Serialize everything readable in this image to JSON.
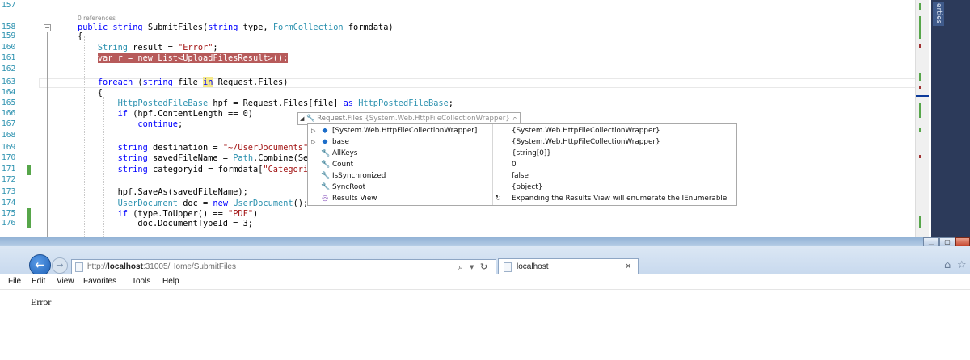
{
  "editor": {
    "lines": [
      {
        "num": "157",
        "segments": []
      },
      {
        "num": "",
        "segments": [
          {
            "t": "0 references",
            "c": "refs"
          }
        ]
      },
      {
        "num": "158",
        "segments": [
          {
            "t": "public ",
            "c": "kw"
          },
          {
            "t": "string ",
            "c": "kw"
          },
          {
            "t": "SubmitFiles(",
            "c": ""
          },
          {
            "t": "string ",
            "c": "kw"
          },
          {
            "t": "type, ",
            "c": ""
          },
          {
            "t": "FormCollection",
            "c": "ty"
          },
          {
            "t": " formdata)",
            "c": ""
          }
        ]
      },
      {
        "num": "159",
        "segments": [
          {
            "t": "{",
            "c": ""
          }
        ]
      },
      {
        "num": "160",
        "segments": [
          {
            "t": "    ",
            "c": ""
          },
          {
            "t": "String",
            "c": "ty"
          },
          {
            "t": " result = ",
            "c": ""
          },
          {
            "t": "\"Error\"",
            "c": "st"
          },
          {
            "t": ";",
            "c": ""
          }
        ]
      },
      {
        "num": "161",
        "segments": [
          {
            "t": "    ",
            "c": ""
          },
          {
            "t": "var r = new List<UploadFilesResult>();",
            "c": "hl-line"
          }
        ]
      },
      {
        "num": "162",
        "segments": []
      },
      {
        "num": "163",
        "segments": [
          {
            "t": "    ",
            "c": ""
          },
          {
            "t": "foreach ",
            "c": "kw"
          },
          {
            "t": "(",
            "c": ""
          },
          {
            "t": "string ",
            "c": "kw"
          },
          {
            "t": "file ",
            "c": ""
          },
          {
            "t": "in",
            "c": "kw hl-in"
          },
          {
            "t": " Request.Files)",
            "c": ""
          }
        ]
      },
      {
        "num": "164",
        "segments": [
          {
            "t": "    {",
            "c": ""
          }
        ]
      },
      {
        "num": "165",
        "segments": [
          {
            "t": "        ",
            "c": ""
          },
          {
            "t": "HttpPostedFileBase",
            "c": "ty"
          },
          {
            "t": " hpf = Request.Files[file] ",
            "c": ""
          },
          {
            "t": "as ",
            "c": "kw"
          },
          {
            "t": "HttpPostedFileBase",
            "c": "ty"
          },
          {
            "t": ";",
            "c": ""
          }
        ]
      },
      {
        "num": "166",
        "segments": [
          {
            "t": "        ",
            "c": ""
          },
          {
            "t": "if ",
            "c": "kw"
          },
          {
            "t": "(hpf.ContentLength == 0)",
            "c": ""
          }
        ]
      },
      {
        "num": "167",
        "segments": [
          {
            "t": "            ",
            "c": ""
          },
          {
            "t": "continue",
            "c": "kw"
          },
          {
            "t": ";",
            "c": ""
          }
        ]
      },
      {
        "num": "168",
        "segments": []
      },
      {
        "num": "169",
        "segments": [
          {
            "t": "        ",
            "c": ""
          },
          {
            "t": "string ",
            "c": "kw"
          },
          {
            "t": "destination = ",
            "c": ""
          },
          {
            "t": "\"~/UserDocuments\"",
            "c": "st"
          }
        ]
      },
      {
        "num": "170",
        "segments": [
          {
            "t": "        ",
            "c": ""
          },
          {
            "t": "string ",
            "c": "kw"
          },
          {
            "t": "savedFileName = ",
            "c": ""
          },
          {
            "t": "Path",
            "c": "ty"
          },
          {
            "t": ".Combine(Se",
            "c": ""
          }
        ]
      },
      {
        "num": "171",
        "segments": [
          {
            "t": "        ",
            "c": ""
          },
          {
            "t": "string ",
            "c": "kw"
          },
          {
            "t": "categoryid = formdata[",
            "c": ""
          },
          {
            "t": "\"Categori",
            "c": "st"
          }
        ]
      },
      {
        "num": "172",
        "segments": []
      },
      {
        "num": "173",
        "segments": [
          {
            "t": "        hpf.SaveAs(savedFileName);",
            "c": ""
          }
        ]
      },
      {
        "num": "174",
        "segments": [
          {
            "t": "        ",
            "c": ""
          },
          {
            "t": "UserDocument",
            "c": "ty"
          },
          {
            "t": " doc = ",
            "c": ""
          },
          {
            "t": "new ",
            "c": "kw"
          },
          {
            "t": "UserDocument",
            "c": "ty"
          },
          {
            "t": "();",
            "c": ""
          }
        ]
      },
      {
        "num": "175",
        "segments": [
          {
            "t": "        ",
            "c": ""
          },
          {
            "t": "if ",
            "c": "kw"
          },
          {
            "t": "(type.ToUpper() == ",
            "c": ""
          },
          {
            "t": "\"PDF\"",
            "c": "st"
          },
          {
            "t": ")",
            "c": ""
          }
        ]
      },
      {
        "num": "176",
        "segments": [
          {
            "t": "            doc.DocumentTypeId = 3;",
            "c": ""
          }
        ]
      }
    ]
  },
  "datatip": {
    "expression": "Request.Files",
    "value": "{System.Web.HttpFileCollectionWrapper}",
    "rows": [
      {
        "expand": "▷",
        "icon": "object-icon",
        "name": "[System.Web.HttpFileCollectionWrapper]",
        "value": "{System.Web.HttpFileCollectionWrapper}"
      },
      {
        "expand": "▷",
        "icon": "object-icon",
        "name": "base",
        "value": "{System.Web.HttpFileCollectionWrapper}"
      },
      {
        "expand": "",
        "icon": "wrench-icon",
        "name": "AllKeys",
        "value": "{string[0]}"
      },
      {
        "expand": "",
        "icon": "wrench-icon",
        "name": "Count",
        "value": "0"
      },
      {
        "expand": "",
        "icon": "wrench-icon",
        "name": "IsSynchronized",
        "value": "false"
      },
      {
        "expand": "",
        "icon": "wrench-icon",
        "name": "SyncRoot",
        "value": "{object}"
      },
      {
        "expand": "",
        "icon": "results-view-icon",
        "name": "Results View",
        "value": "Expanding the Results View will enumerate the IEnumerable",
        "value_icon": "refresh-icon"
      }
    ]
  },
  "side_panel": {
    "label": "erties"
  },
  "browser": {
    "url_prefix": "http://",
    "url_host": "localhost",
    "url_rest": ":31005/Home/SubmitFiles",
    "tab_title": "localhost",
    "menu": [
      "File",
      "Edit",
      "View",
      "Favorites",
      "Tools",
      "Help"
    ],
    "page_text": "Error"
  },
  "colors": {
    "keyword": "#0000ff",
    "type": "#2b91af",
    "string": "#a31515",
    "breakpoint_highlight": "#b75a5a",
    "ie_back_button": "#1d5fb5"
  }
}
